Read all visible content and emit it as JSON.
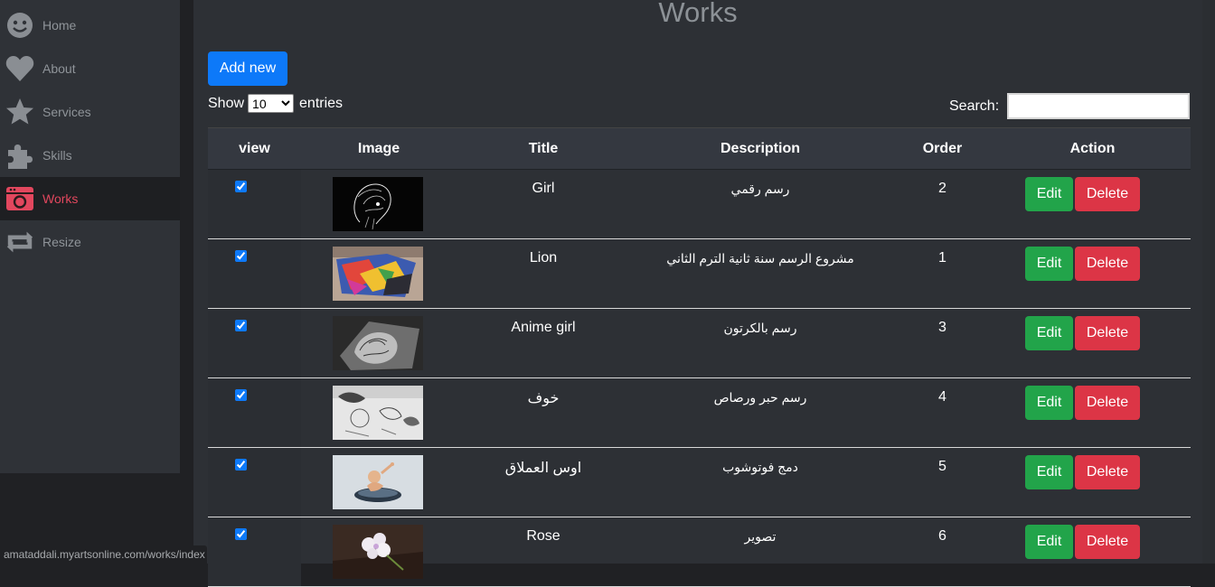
{
  "sidebar": {
    "items": [
      {
        "label": "Home",
        "icon": "smiley-icon"
      },
      {
        "label": "About",
        "icon": "heart-icon"
      },
      {
        "label": "Services",
        "icon": "star-icon"
      },
      {
        "label": "Skills",
        "icon": "puzzle-icon"
      },
      {
        "label": "Works",
        "icon": "camera-icon",
        "active": true
      },
      {
        "label": "Resize",
        "icon": "resize-icon"
      }
    ]
  },
  "main": {
    "title": "Works",
    "add_new_label": "Add new",
    "show_label": "Show",
    "entries_label": "entries",
    "page_size": "10",
    "search_label": "Search:",
    "search_value": ""
  },
  "table": {
    "headers": [
      "view",
      "Image",
      "Title",
      "Description",
      "Order",
      "Action"
    ],
    "edit_label": "Edit",
    "delete_label": "Delete",
    "rows": [
      {
        "view": true,
        "title": "Girl",
        "description": "رسم رقمي",
        "order": "2"
      },
      {
        "view": true,
        "title": "Lion",
        "description": "مشروع الرسم سنة ثانية الترم الثاني",
        "order": "1"
      },
      {
        "view": true,
        "title": "Anime girl",
        "description": "رسم بالكرتون",
        "order": "3"
      },
      {
        "view": true,
        "title": "خوف",
        "description": "رسم حبر ورصاص",
        "order": "4"
      },
      {
        "view": true,
        "title": "اوس العملاق",
        "description": "دمج فوتوشوب",
        "order": "5"
      },
      {
        "view": true,
        "title": "Rose",
        "description": "تصوير",
        "order": "6"
      }
    ]
  },
  "statusbar": {
    "url": "amataddali.myartsonline.com/works/index"
  },
  "colors": {
    "accent_active": "#e2475e",
    "add_button": "#0d79f9",
    "edit_button": "#22a44a",
    "delete_button": "#dc3546"
  }
}
